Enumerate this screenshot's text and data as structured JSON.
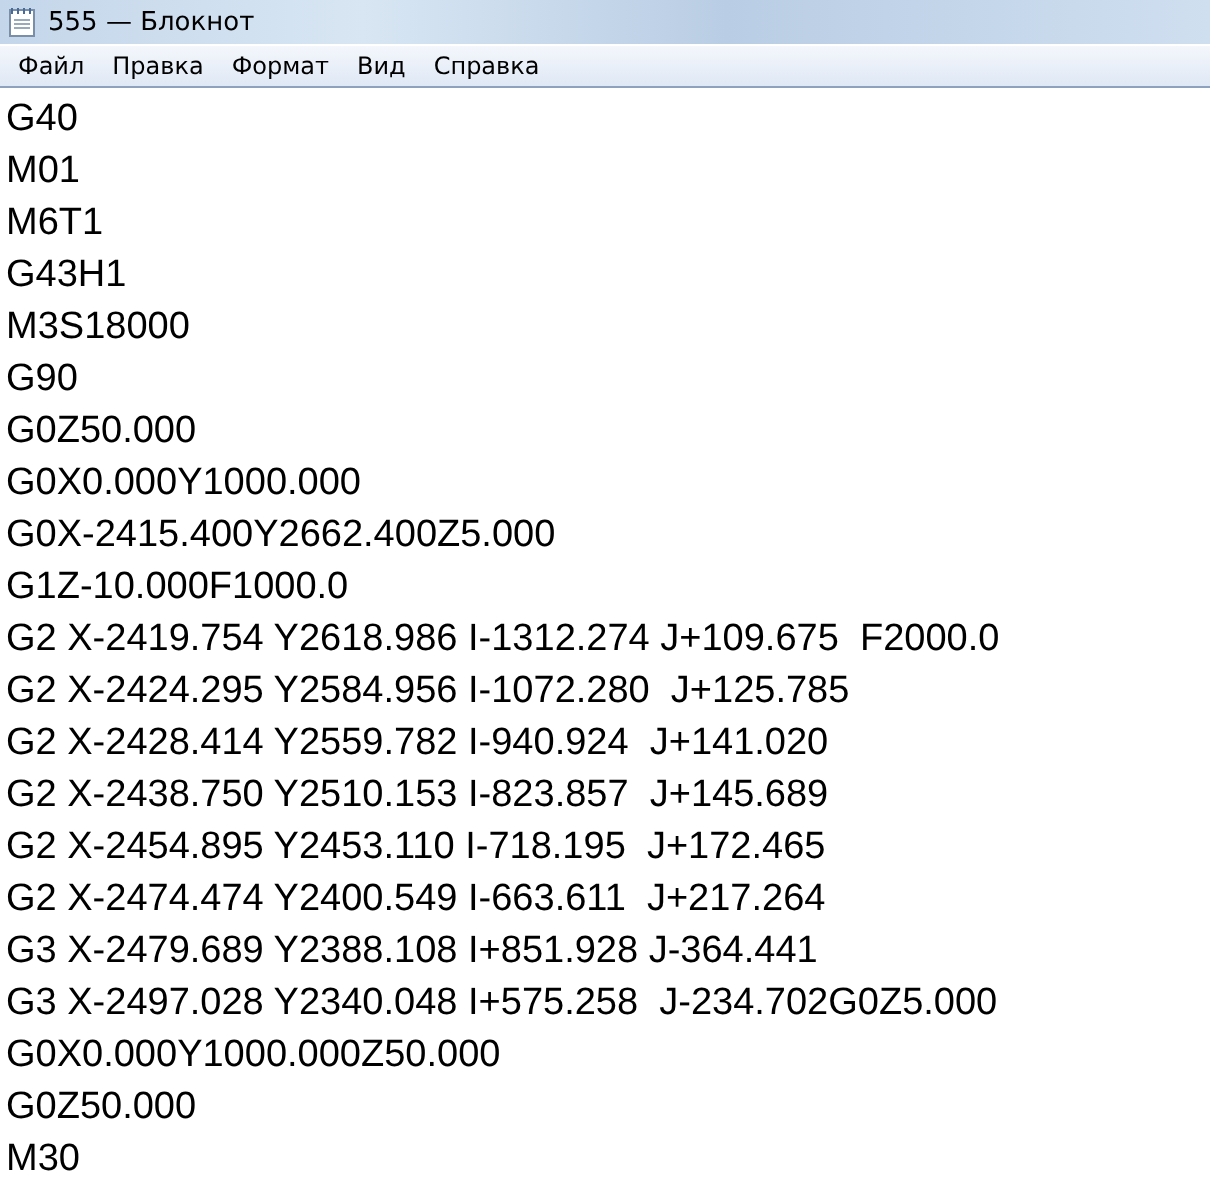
{
  "window": {
    "title": "555 — Блокнот"
  },
  "menu": [
    "Файл",
    "Правка",
    "Формат",
    "Вид",
    "Справка"
  ],
  "lines": [
    "G40",
    "M01",
    "M6T1",
    "G43H1",
    "M3S18000",
    "G90",
    "G0Z50.000",
    "G0X0.000Y1000.000",
    "G0X-2415.400Y2662.400Z5.000",
    "G1Z-10.000F1000.0",
    "G2 X-2419.754 Y2618.986 I-1312.274 J+109.675  F2000.0",
    "G2 X-2424.295 Y2584.956 I-1072.280  J+125.785",
    "G2 X-2428.414 Y2559.782 I-940.924  J+141.020",
    "G2 X-2438.750 Y2510.153 I-823.857  J+145.689",
    "G2 X-2454.895 Y2453.110 I-718.195  J+172.465",
    "G2 X-2474.474 Y2400.549 I-663.611  J+217.264",
    "G3 X-2479.689 Y2388.108 I+851.928 J-364.441",
    "G3 X-2497.028 Y2340.048 I+575.258  J-234.702G0Z5.000",
    "G0X0.000Y1000.000Z50.000",
    "G0Z50.000",
    "M30"
  ]
}
